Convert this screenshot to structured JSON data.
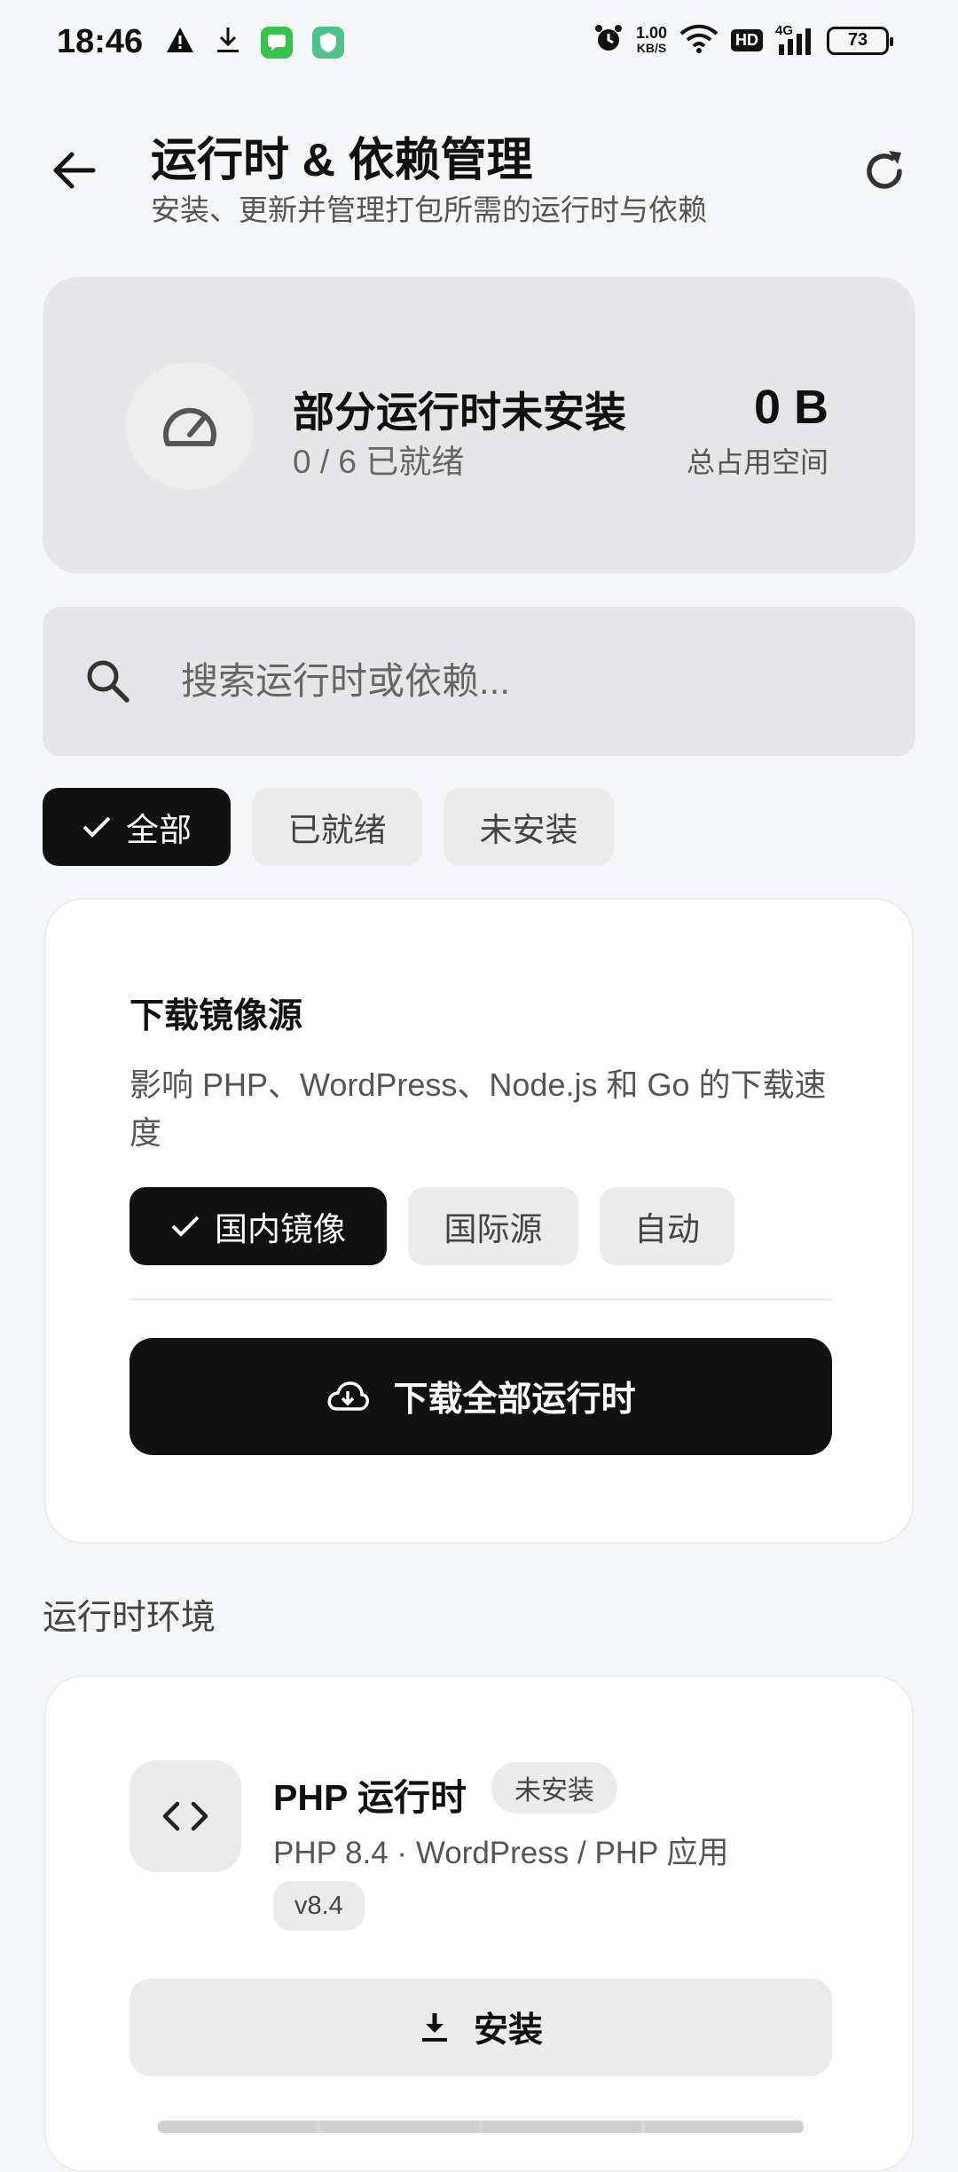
{
  "status_bar": {
    "time": "18:46",
    "net_speed_value": "1.00",
    "net_speed_unit": "KB/S",
    "hd_label": "HD",
    "network_type": "4G",
    "battery": "73"
  },
  "header": {
    "title": "运行时 & 依赖管理",
    "subtitle": "安装、更新并管理打包所需的运行时与依赖"
  },
  "summary": {
    "title": "部分运行时未安装",
    "ready_count": "0 / 6 已就绪",
    "total_size": "0 B",
    "total_size_label": "总占用空间"
  },
  "search": {
    "placeholder": "搜索运行时或依赖..."
  },
  "filters": {
    "items": [
      {
        "label": "全部",
        "selected": true
      },
      {
        "label": "已就绪",
        "selected": false
      },
      {
        "label": "未安装",
        "selected": false
      }
    ]
  },
  "mirror": {
    "title": "下载镜像源",
    "description": "影响 PHP、WordPress、Node.js 和 Go 的下载速度",
    "options": [
      {
        "label": "国内镜像",
        "selected": true
      },
      {
        "label": "国际源",
        "selected": false
      },
      {
        "label": "自动",
        "selected": false
      }
    ],
    "download_all_label": "下载全部运行时"
  },
  "runtimes_section": {
    "label": "运行时环境",
    "items": [
      {
        "name": "PHP 运行时",
        "status": "未安装",
        "description": "PHP 8.4 · WordPress / PHP 应用",
        "version": "v8.4",
        "action_label": "安装"
      }
    ]
  },
  "colors": {
    "accent": "#111111",
    "card_bg": "#ffffff",
    "surface": "#e6e6e8",
    "page_bg": "#f5f6f8"
  }
}
